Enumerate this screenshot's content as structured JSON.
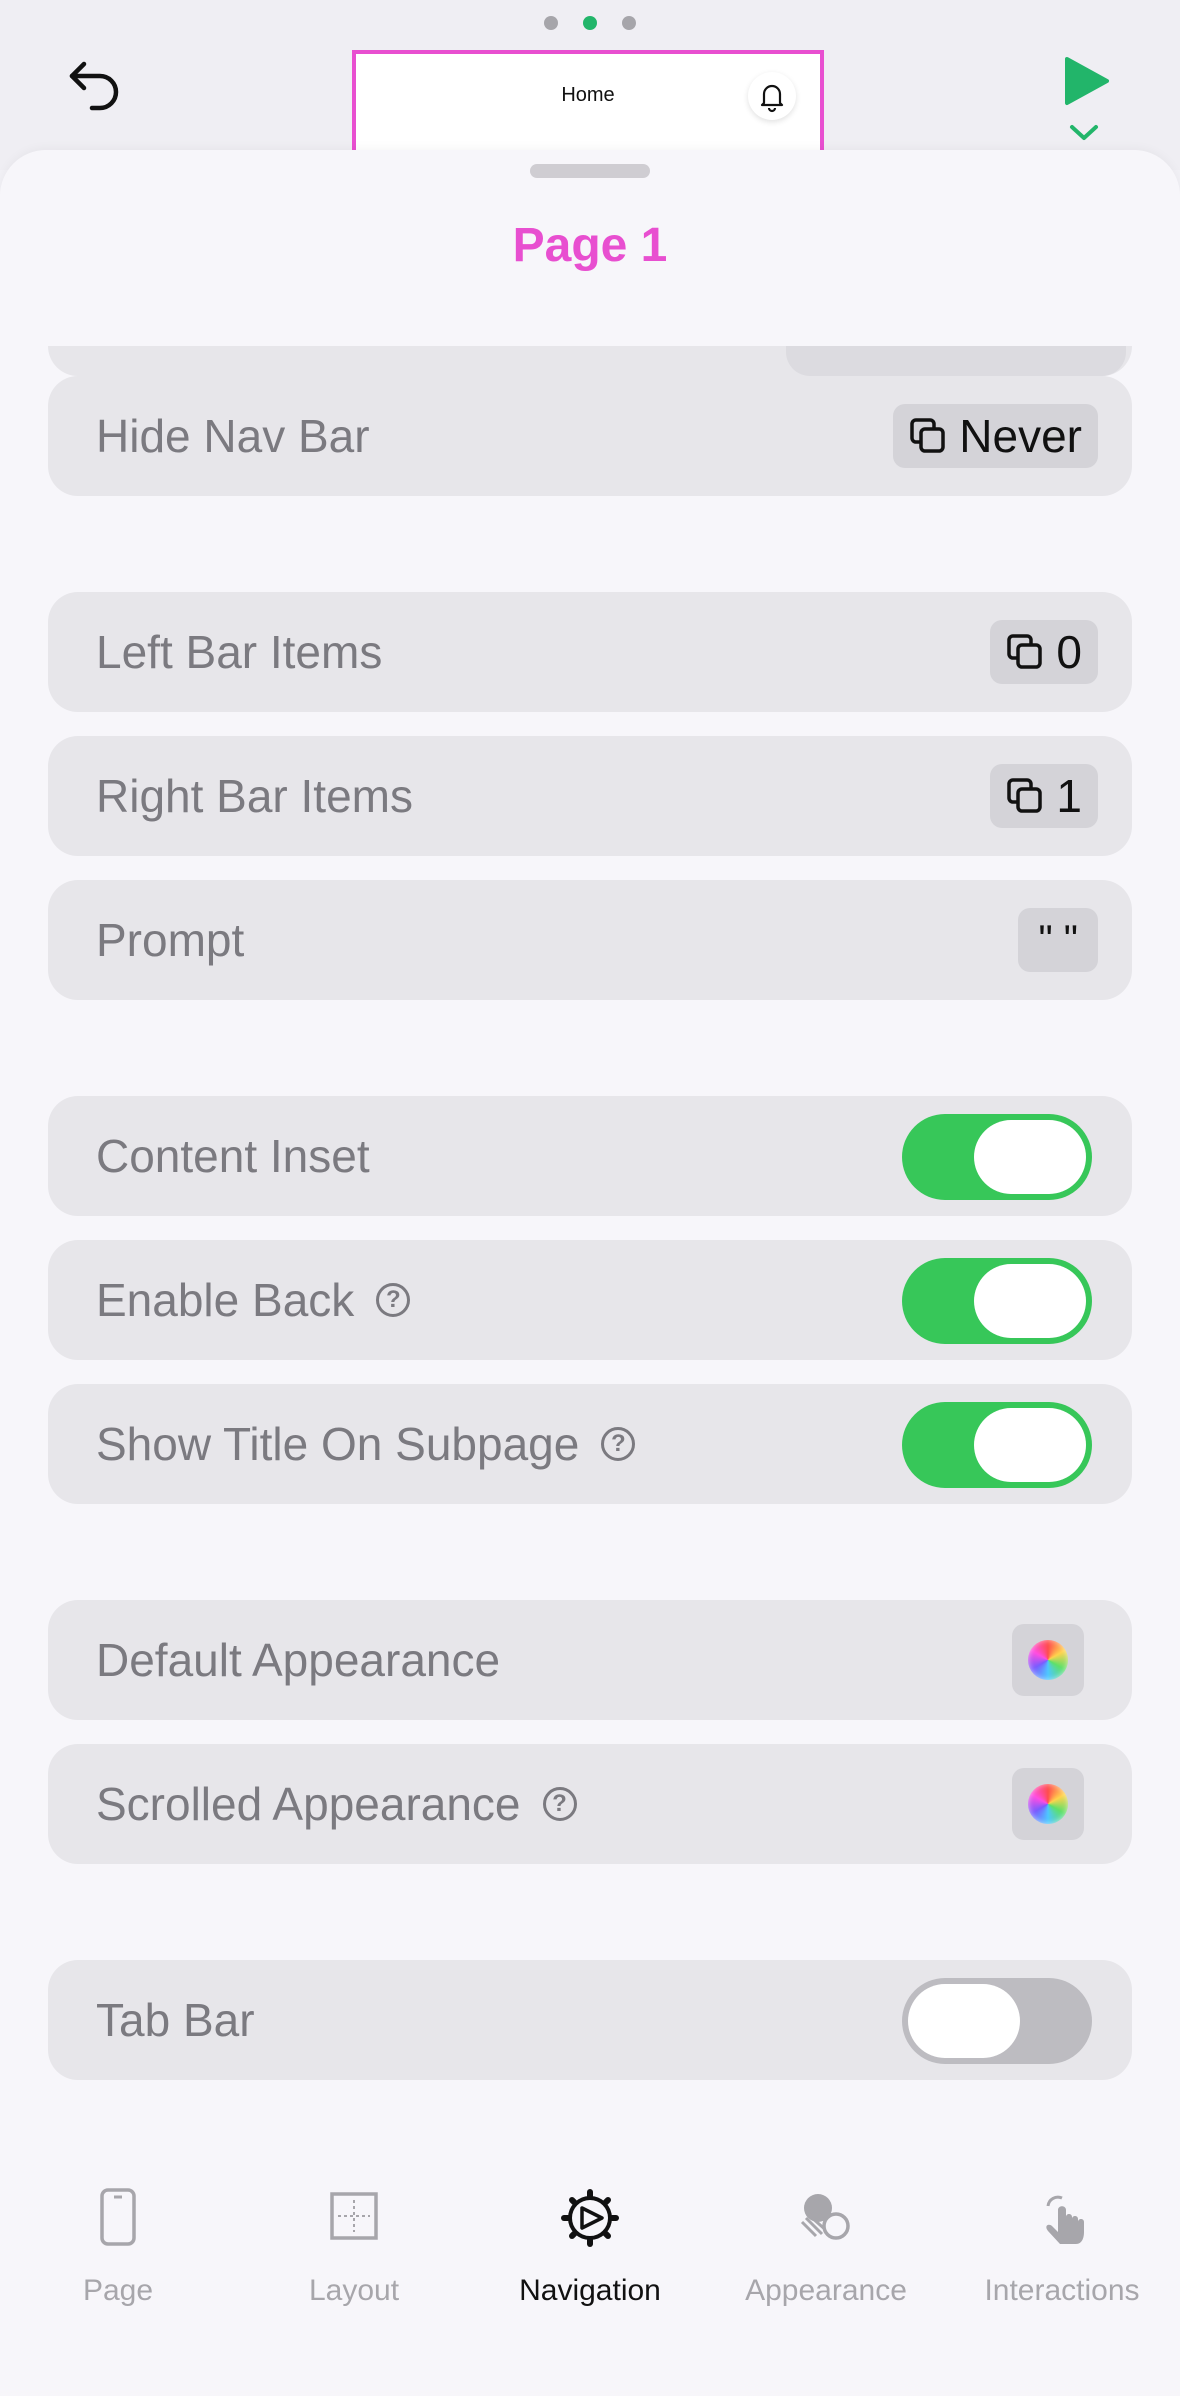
{
  "top_bar": {
    "pager_dots": 3,
    "active_dot": 1,
    "preview_title": "Home"
  },
  "sheet": {
    "title": "Page 1"
  },
  "rows": {
    "hide_nav_bar": {
      "label": "Hide Nav Bar",
      "value": "Never"
    },
    "left_bar_items": {
      "label": "Left Bar Items",
      "value": "0"
    },
    "right_bar_items": {
      "label": "Right Bar Items",
      "value": "1"
    },
    "prompt": {
      "label": "Prompt",
      "value": "\" \""
    },
    "content_inset": {
      "label": "Content Inset",
      "on": true
    },
    "enable_back": {
      "label": "Enable Back",
      "on": true
    },
    "show_title_on_subpage": {
      "label": "Show Title On Subpage",
      "on": true
    },
    "default_appearance": {
      "label": "Default Appearance"
    },
    "scrolled_appearance": {
      "label": "Scrolled Appearance"
    },
    "tab_bar": {
      "label": "Tab Bar",
      "on": false
    }
  },
  "help_glyph": "?",
  "tabs": [
    {
      "label": "Page",
      "icon": "phone-icon"
    },
    {
      "label": "Layout",
      "icon": "layout-grid-icon"
    },
    {
      "label": "Navigation",
      "icon": "navigation-gear-icon",
      "active": true
    },
    {
      "label": "Appearance",
      "icon": "appearance-icon"
    },
    {
      "label": "Interactions",
      "icon": "hand-tap-icon"
    }
  ],
  "colors": {
    "accent_pink": "#e84fd0",
    "toggle_green": "#37c759",
    "play_green": "#22b56a",
    "row_background": "#e7e6ea"
  }
}
